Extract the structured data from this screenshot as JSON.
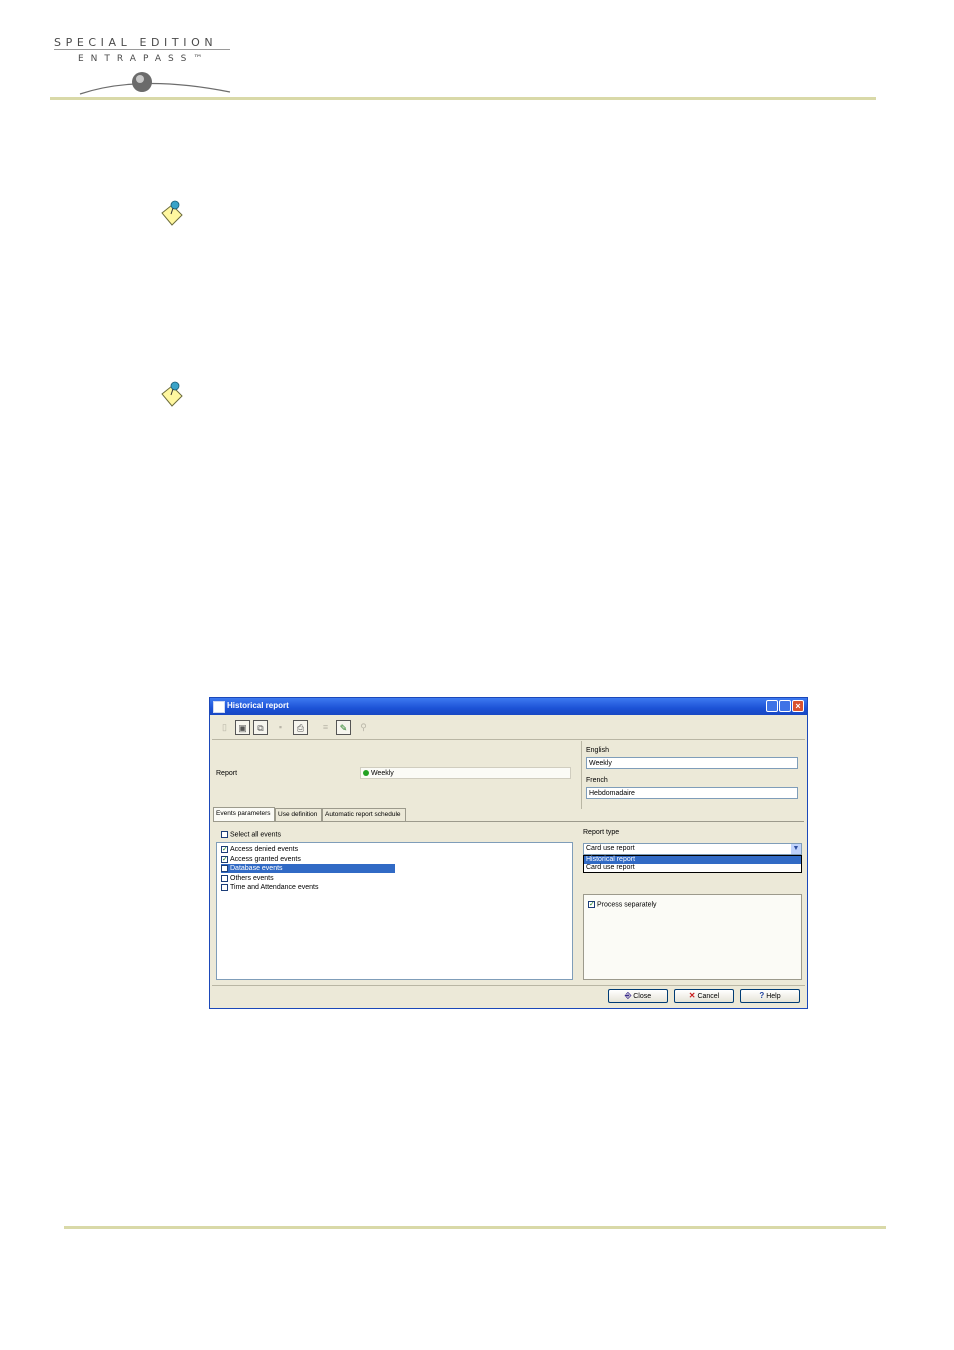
{
  "header": {
    "logo_line1": "SPECIAL EDITION",
    "logo_line2": "ENTRAPASS™"
  },
  "icons": {
    "note": "note-pin-icon"
  },
  "dialog": {
    "title": "Historical report",
    "report_label": "Report",
    "report_value": "Weekly",
    "english_label": "English",
    "english_value": "Weekly",
    "french_label": "French",
    "french_value": "Hebdomadaire",
    "tabs": [
      {
        "label": "Events parameters"
      },
      {
        "label": "Use definition"
      },
      {
        "label": "Automatic report schedule"
      }
    ],
    "select_all_label": "Select all events",
    "events": [
      {
        "label": "Access denied events",
        "checked": true
      },
      {
        "label": "Access granted events",
        "checked": true
      },
      {
        "label": "Database events",
        "checked": false
      },
      {
        "label": "Others events",
        "checked": false
      },
      {
        "label": "Time and Attendance events",
        "checked": false
      }
    ],
    "report_type_label": "Report type",
    "report_type_value": "Card use report",
    "report_type_options": [
      {
        "label": "Historical report"
      },
      {
        "label": "Card use report"
      }
    ],
    "process_separately_label": "Process separately",
    "buttons": {
      "close": "Close",
      "cancel": "Cancel",
      "help": "Help"
    }
  }
}
